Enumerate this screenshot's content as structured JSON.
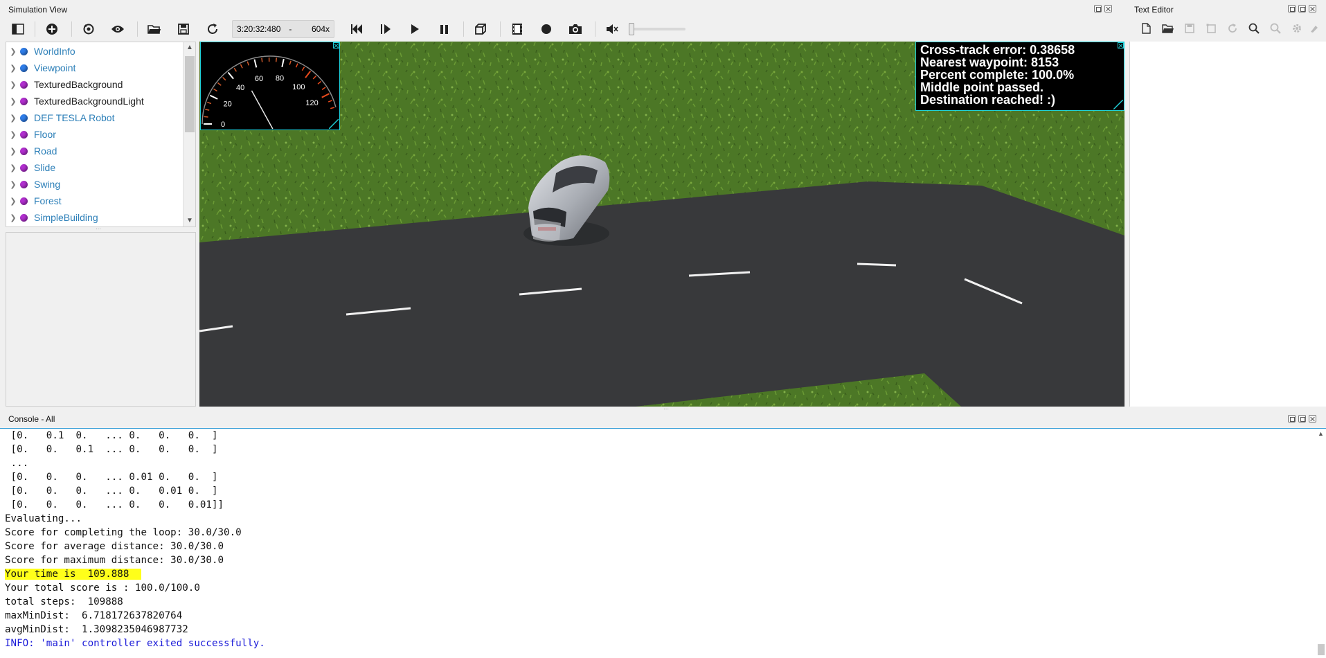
{
  "sim_panel": {
    "title": "Simulation View"
  },
  "text_editor": {
    "title": "Text Editor"
  },
  "console_panel": {
    "title": "Console - All"
  },
  "toolbar": {
    "time": "3:20:32:480",
    "time_separator": "-",
    "speed": "604x",
    "icons": [
      "toggle-scene-tree-icon",
      "add-node-icon",
      "reset-view-icon",
      "eye-icon",
      "open-world-icon",
      "save-world-icon",
      "reload-world-icon",
      "step-back-icon",
      "step-icon",
      "play-icon",
      "pause-icon",
      "view-3d-icon",
      "video-record-icon",
      "record-dot-icon",
      "screenshot-icon",
      "mute-icon"
    ],
    "volume": 0
  },
  "scene_tree": {
    "items": [
      {
        "label": "WorldInfo",
        "dot": "blue",
        "style": "link"
      },
      {
        "label": "Viewpoint",
        "dot": "blue",
        "style": "link"
      },
      {
        "label": "TexturedBackground",
        "dot": "purple",
        "style": "plain"
      },
      {
        "label": "TexturedBackgroundLight",
        "dot": "purple",
        "style": "plain"
      },
      {
        "label": "DEF TESLA Robot",
        "dot": "blue",
        "style": "link"
      },
      {
        "label": "Floor",
        "dot": "purple",
        "style": "link"
      },
      {
        "label": "Road",
        "dot": "purple",
        "style": "link"
      },
      {
        "label": "Slide",
        "dot": "purple",
        "style": "link"
      },
      {
        "label": "Swing",
        "dot": "purple",
        "style": "link"
      },
      {
        "label": "Forest",
        "dot": "purple",
        "style": "link"
      },
      {
        "label": "SimpleBuilding",
        "dot": "purple",
        "style": "link"
      }
    ]
  },
  "speedometer": {
    "ticks": [
      "0",
      "20",
      "40",
      "60",
      "80",
      "100",
      "120"
    ],
    "needle_kmh": 48
  },
  "hud": {
    "lines": [
      "Cross-track error: 0.38658",
      "Nearest waypoint: 8153",
      "Percent complete: 100.0%",
      "Middle point passed.",
      "Destination reached! :)"
    ]
  },
  "console": {
    "lines": [
      {
        "text": " [0.   0.1  0.   ... 0.   0.   0.  ]",
        "kind": "normal"
      },
      {
        "text": " [0.   0.   0.1  ... 0.   0.   0.  ]",
        "kind": "normal"
      },
      {
        "text": " ...",
        "kind": "normal"
      },
      {
        "text": " [0.   0.   0.   ... 0.01 0.   0.  ]",
        "kind": "normal"
      },
      {
        "text": " [0.   0.   0.   ... 0.   0.01 0.  ]",
        "kind": "normal"
      },
      {
        "text": " [0.   0.   0.   ... 0.   0.   0.01]]",
        "kind": "normal"
      },
      {
        "text": "Evaluating...",
        "kind": "normal"
      },
      {
        "text": "Score for completing the loop: 30.0/30.0",
        "kind": "normal"
      },
      {
        "text": "Score for average distance: 30.0/30.0",
        "kind": "normal"
      },
      {
        "text": "Score for maximum distance: 30.0/30.0",
        "kind": "normal"
      },
      {
        "text": "Your time is  109.888",
        "kind": "highlight"
      },
      {
        "text": "Your total score is : 100.0/100.0",
        "kind": "normal"
      },
      {
        "text": "total steps:  109888",
        "kind": "normal"
      },
      {
        "text": "maxMinDist:  6.718172637820764",
        "kind": "normal"
      },
      {
        "text": "avgMinDist:  1.3098235046987732",
        "kind": "normal"
      },
      {
        "text": "INFO: 'main' controller exited successfully.",
        "kind": "info"
      }
    ]
  },
  "colors": {
    "hud_border": "#1fd0d8",
    "highlight": "#ffff1a",
    "info_text": "#1a1ad8",
    "link": "#2c7fb8",
    "grass": "#4f7a26",
    "road": "#38393b"
  }
}
